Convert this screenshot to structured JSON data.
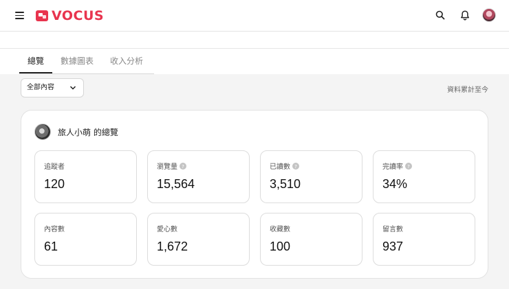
{
  "app": {
    "logo_text": "VOCUS",
    "brand_color": "#e8344e"
  },
  "header_icons": [
    "menu-icon",
    "search-icon",
    "bell-icon",
    "user-avatar"
  ],
  "tabs": [
    {
      "label": "總覽",
      "active": true
    },
    {
      "label": "數據圖表",
      "active": false
    },
    {
      "label": "收入分析",
      "active": false
    }
  ],
  "filter": {
    "selected": "全部內容"
  },
  "accumulated_note": "資料累計至今",
  "panel": {
    "title": "旅人小萌 的總覽"
  },
  "stats": [
    {
      "label": "追蹤者",
      "value": "120",
      "has_help": false
    },
    {
      "label": "瀏覽量",
      "value": "15,564",
      "has_help": true
    },
    {
      "label": "已讀數",
      "value": "3,510",
      "has_help": true
    },
    {
      "label": "完讀率",
      "value": "34%",
      "has_help": true
    },
    {
      "label": "內容數",
      "value": "61",
      "has_help": false
    },
    {
      "label": "愛心數",
      "value": "1,672",
      "has_help": false
    },
    {
      "label": "收藏數",
      "value": "100",
      "has_help": false
    },
    {
      "label": "留言數",
      "value": "937",
      "has_help": false
    }
  ]
}
